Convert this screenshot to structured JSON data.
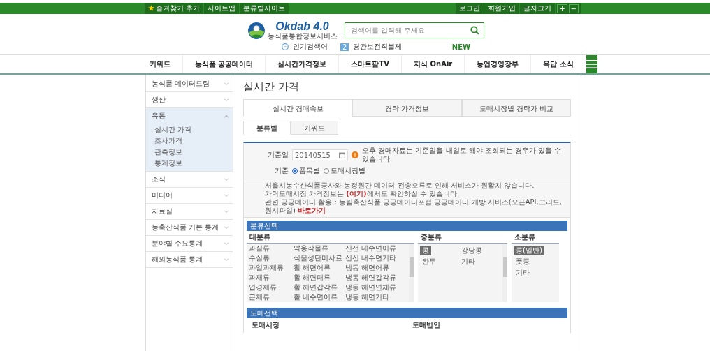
{
  "top_bar": {
    "left_links": [
      {
        "label": "즐겨찾기 추가",
        "kind": "favorite"
      },
      {
        "label": "사이트맵",
        "kind": "plain"
      },
      {
        "label": "분류별사이트",
        "kind": "plain"
      }
    ],
    "right_links": [
      "로그인",
      "회원가입"
    ],
    "font_size": {
      "label": "글자크기",
      "buttons": [
        "+",
        "−"
      ]
    }
  },
  "header": {
    "logo": {
      "title": "Okdab 4.0",
      "subtitle": "농식품통합정보서비스"
    },
    "search": {
      "placeholder": "검색어를 입력해 주세요"
    },
    "trending": {
      "label": "인기검색어",
      "rank": "2",
      "term": "경관보전직불제",
      "badge": "NEW"
    }
  },
  "nav": {
    "items": [
      "키워드",
      "농식품 공공데이터",
      "실시간가격정보",
      "스마트팜TV",
      "지식 OnAir",
      "농업경영장부",
      "옥답 소식"
    ]
  },
  "sidebar": {
    "items": [
      {
        "label": "농식품 데이터드림",
        "expanded": false
      },
      {
        "label": "생산",
        "expanded": false
      },
      {
        "label": "유통",
        "expanded": true,
        "children": [
          "실시간 가격",
          "조사가격",
          "관측정보",
          "통계정보"
        ]
      },
      {
        "label": "소식",
        "expanded": false
      },
      {
        "label": "미디어",
        "expanded": false
      },
      {
        "label": "자료실",
        "expanded": false
      },
      {
        "label": "농축산식품 기본 통계",
        "expanded": false
      },
      {
        "label": "분야별 주요통계",
        "expanded": false
      },
      {
        "label": "해외농식품 통계",
        "expanded": false
      }
    ]
  },
  "page_title": "실시간 가격",
  "tabs": [
    {
      "label": "실시간 경매속보",
      "selected": true
    },
    {
      "label": "경락 가격정보",
      "selected": false
    },
    {
      "label": "도매시장별 경락가 비교",
      "selected": false
    }
  ],
  "subtabs": [
    {
      "label": "분류별",
      "selected": true
    },
    {
      "label": "키워드",
      "selected": false
    }
  ],
  "form": {
    "date_label": "기준일",
    "date": "20140515",
    "date_notice": "오후 경매자료는 기준일을 내일로 해야 조회되는 경우가 있을 수 있습니다.",
    "basis_label": "기준",
    "basis_options": [
      {
        "label": "품목별",
        "selected": true
      },
      {
        "label": "도매시장별",
        "selected": false
      }
    ]
  },
  "notice": [
    [
      {
        "kind": "text",
        "text": "서울시농수산식품공사와 농정원간 데이터 전송오류로 인해 서비스가 원활치 않습니다."
      }
    ],
    [
      {
        "kind": "text",
        "text": "가락도매시장 가격정보는 "
      },
      {
        "kind": "link",
        "text": "(여기)"
      },
      {
        "kind": "text",
        "text": "에서도 확인하실 수 있습니다."
      }
    ],
    [
      {
        "kind": "text",
        "text": "관련 공공데이터 활용 : 농림축산식품 공공데이터포털 공공데이터 개방 서비스(오픈API,그리드,원시파일) "
      },
      {
        "kind": "link",
        "text": "바로가기"
      }
    ]
  ],
  "category": {
    "title": "분류선택",
    "large": {
      "label": "대분류",
      "items": [
        "과실류",
        "약용작물류",
        "신선 내수면어류",
        "수실류",
        "식물성단미사료",
        "신선 내수면기타",
        "과일과채류",
        "활 해면어류",
        "냉동 해면어류",
        "과채류",
        "활 해면패류",
        "냉동 해면갑각류",
        "엽경채류",
        "활 해면갑각류",
        "냉동 해면연체류",
        "근채류",
        "활 내수면어류",
        "냉동 해면기타"
      ]
    },
    "medium": {
      "label": "중분류",
      "items": [
        {
          "label": "콩",
          "selected": true
        },
        {
          "label": "강낭콩",
          "selected": false
        },
        {
          "label": "완두",
          "selected": false
        },
        {
          "label": "기타",
          "selected": false
        }
      ]
    },
    "small": {
      "label": "소분류",
      "items": [
        {
          "label": "콩(일반)",
          "selected": true
        },
        {
          "label": "풋콩",
          "selected": false
        },
        {
          "label": "기타",
          "selected": false
        }
      ]
    }
  },
  "wholesale": {
    "title": "도매선택",
    "market_label": "도매시장",
    "corp_label": "도매법인"
  }
}
